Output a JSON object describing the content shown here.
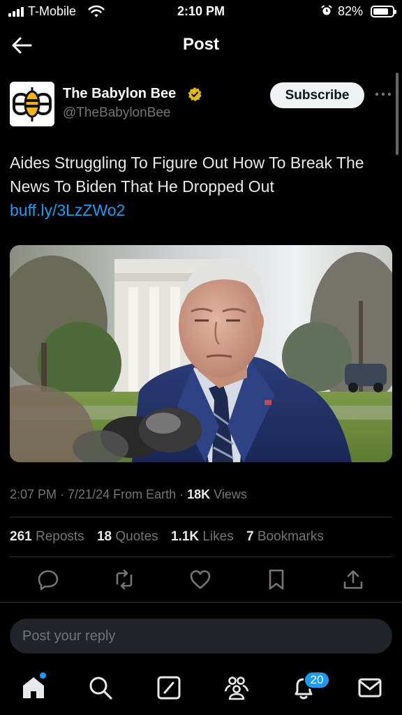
{
  "status_bar": {
    "carrier": "T-Mobile",
    "time": "2:10 PM",
    "battery": "82%",
    "battery_level": 0.82
  },
  "header": {
    "title": "Post",
    "back_icon": "arrow-left-icon"
  },
  "author": {
    "display_name": "The Babylon Bee",
    "handle": "@TheBabylonBee",
    "verified_color": "#e2b719",
    "subscribe_label": "Subscribe"
  },
  "post": {
    "text": "Aides Struggling To Figure Out How To Break The News To Biden That He Dropped Out ",
    "link": "buff.ly/3LzZWo2"
  },
  "meta": {
    "timestamp": "2:07 PM · 7/21/24 From Earth · ",
    "views_count": "18K",
    "views_label": " Views"
  },
  "stats": [
    {
      "count": "261",
      "label": " Reposts"
    },
    {
      "count": "18",
      "label": " Quotes"
    },
    {
      "count": "1.1K",
      "label": " Likes"
    },
    {
      "count": "7",
      "label": " Bookmarks"
    }
  ],
  "actions": [
    "reply-icon",
    "repost-icon",
    "like-icon",
    "bookmark-icon",
    "share-icon"
  ],
  "reply": {
    "placeholder": "Post your reply"
  },
  "nav": {
    "items": [
      "home-icon",
      "search-icon",
      "grok-icon",
      "communities-icon",
      "notifications-icon",
      "messages-icon"
    ],
    "notifications_badge": "20"
  },
  "colors": {
    "background": "#000000",
    "accent": "#1d9bf0",
    "muted": "#71767b",
    "divider": "#2f3336"
  }
}
